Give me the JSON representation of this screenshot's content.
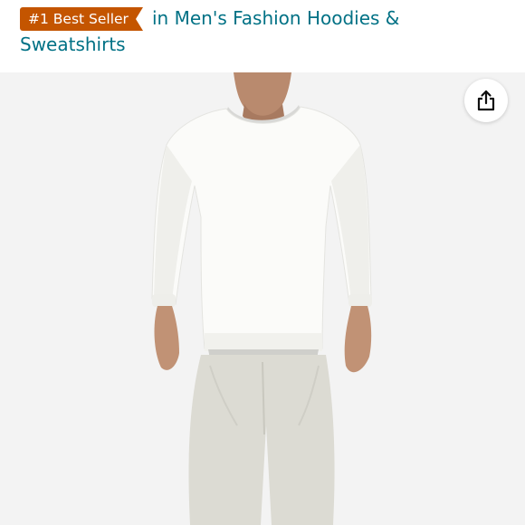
{
  "badge": {
    "label": "#1 Best Seller",
    "color": "#c45500"
  },
  "category": {
    "line1": "in Men's Fashion Hoodies &",
    "line2": "Sweatshirts",
    "link_color": "#007185"
  },
  "share": {
    "icon": "share-icon"
  },
  "product_image": {
    "subject": "man wearing white crewneck sweatshirt and light beige pants"
  }
}
